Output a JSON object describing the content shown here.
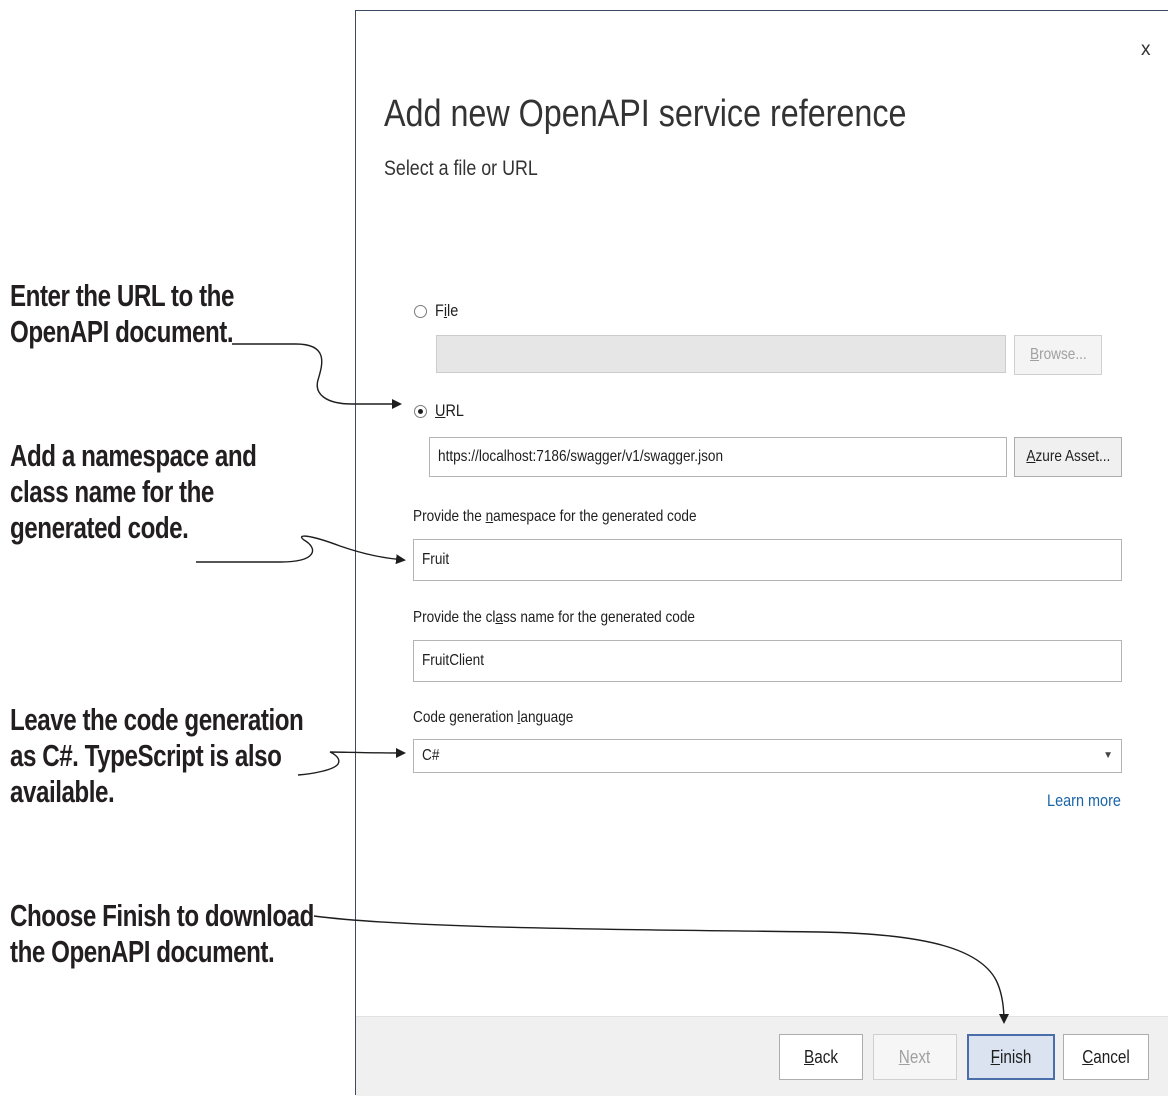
{
  "annotations": {
    "url_callout": [
      "Enter the URL to the",
      "OpenAPI document."
    ],
    "namespace_callout": [
      "Add a namespace and",
      "class name for the",
      "generated code."
    ],
    "language_callout": [
      "Leave the code generation",
      "as C#. TypeScript is also",
      "available."
    ],
    "finish_callout": [
      "Choose Finish to download",
      "the OpenAPI document."
    ]
  },
  "dialog": {
    "close_label": "x",
    "title": "Add new OpenAPI service reference",
    "subtitle": "Select a file or URL",
    "file_option": {
      "pre": "F",
      "accel": "i",
      "post": "le",
      "selected": false
    },
    "file_input": {
      "value": "",
      "disabled": true
    },
    "browse_button": {
      "pre": "",
      "accel": "B",
      "post": "rowse...",
      "disabled": true
    },
    "url_option": {
      "pre": "",
      "accel": "U",
      "post": "RL",
      "selected": true
    },
    "url_input": {
      "value": "https://localhost:7186/swagger/v1/swagger.json"
    },
    "azure_button": {
      "pre": "",
      "accel": "A",
      "post": "zure Asset..."
    },
    "namespace_label": {
      "pre": "Provide the ",
      "accel": "n",
      "post": "amespace for the generated code"
    },
    "namespace_input": {
      "value": "Fruit"
    },
    "classname_label": {
      "pre": "Provide the cl",
      "accel": "a",
      "post": "ss name for the generated code"
    },
    "classname_input": {
      "value": "FruitClient"
    },
    "language_label": {
      "pre": "Code generation ",
      "accel": "l",
      "post": "anguage"
    },
    "language_select": {
      "value": "C#",
      "arrow": "▼"
    },
    "learn_more": "Learn more",
    "footer": {
      "back": {
        "pre": "",
        "accel": "B",
        "post": "ack"
      },
      "next": {
        "pre": "",
        "accel": "N",
        "post": "ext",
        "disabled": true
      },
      "finish": {
        "pre": "",
        "accel": "F",
        "post": "inish",
        "primary": true
      },
      "cancel": {
        "pre": "",
        "accel": "C",
        "post": "ancel"
      }
    }
  }
}
